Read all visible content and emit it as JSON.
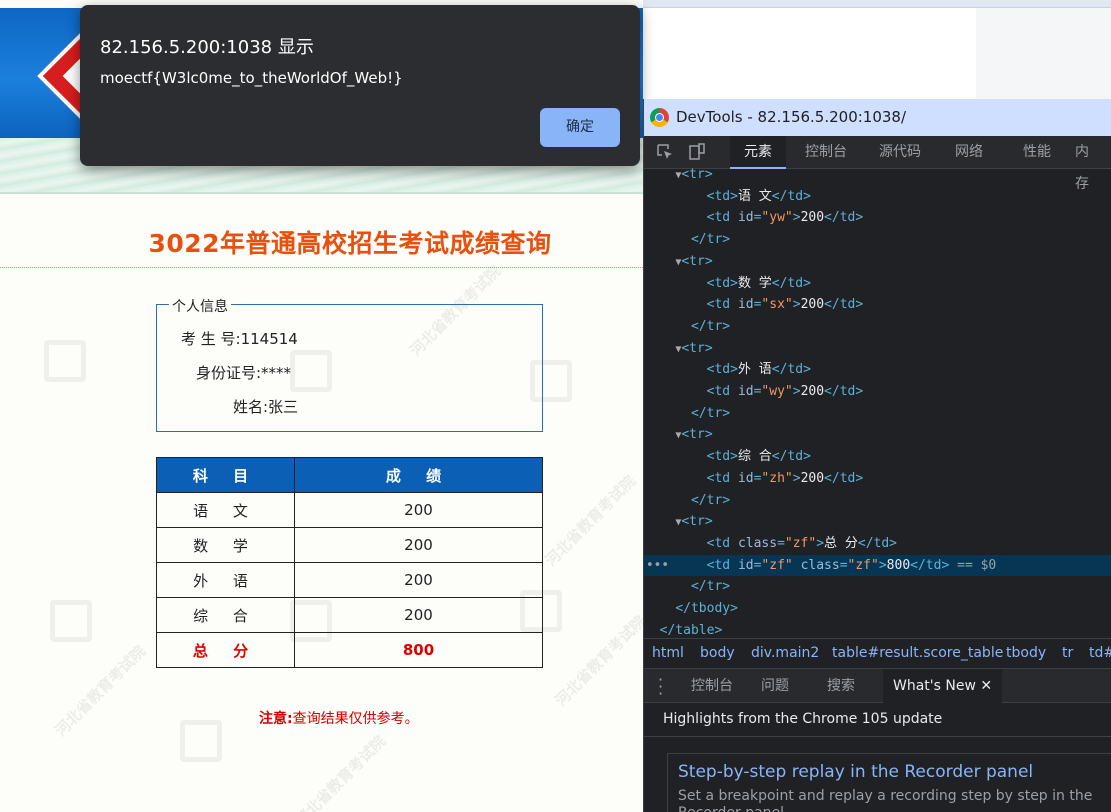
{
  "alert": {
    "title": "82.156.5.200:1038 显示",
    "message": "moectf{W3lc0me_to_theWorldOf_Web!}",
    "ok_label": "确定"
  },
  "page": {
    "banner_logo_icon": "hebei-exam-logo-icon",
    "title": "3022年普通高校招生考试成绩查询",
    "watermark": "河北省教育考试院",
    "info": {
      "legend": "个人信息",
      "exam_no": "考 生 号:114514",
      "id_no": "身份证号:****",
      "name": "姓名:张三"
    },
    "table": {
      "headers": [
        "科  目",
        "成  绩"
      ],
      "rows": [
        {
          "subject": "语  文",
          "score": "200"
        },
        {
          "subject": "数  学",
          "score": "200"
        },
        {
          "subject": "外  语",
          "score": "200"
        },
        {
          "subject": "综  合",
          "score": "200"
        }
      ],
      "total": {
        "subject": "总  分",
        "score": "800"
      }
    },
    "note_label": "注意:",
    "note_text": "查询结果仅供参考。"
  },
  "devtools": {
    "title": "DevTools - 82.156.5.200:1038/",
    "tabs": [
      "元素",
      "控制台",
      "源代码",
      "网络",
      "性能",
      "内存"
    ],
    "active_tab": "元素",
    "breadcrumbs": [
      "html",
      "body",
      "div.main2",
      "table#result.score_table",
      "tbody",
      "tr",
      "td#"
    ],
    "drawer_tabs": [
      "控制台",
      "问题",
      "搜索",
      "What's New"
    ],
    "drawer_active": "What's New",
    "highlights": "Highlights from the Chrome 105 update",
    "card_title": "Step-by-step replay in the Recorder panel",
    "card_text": "Set a breakpoint and replay a recording step by step in the Recorder panel.",
    "selected_suffix": "== $0",
    "colors": {
      "tag": "#5db0d7",
      "attr": "#9bbbdc",
      "value": "#f29766",
      "selection": "#073655"
    }
  }
}
